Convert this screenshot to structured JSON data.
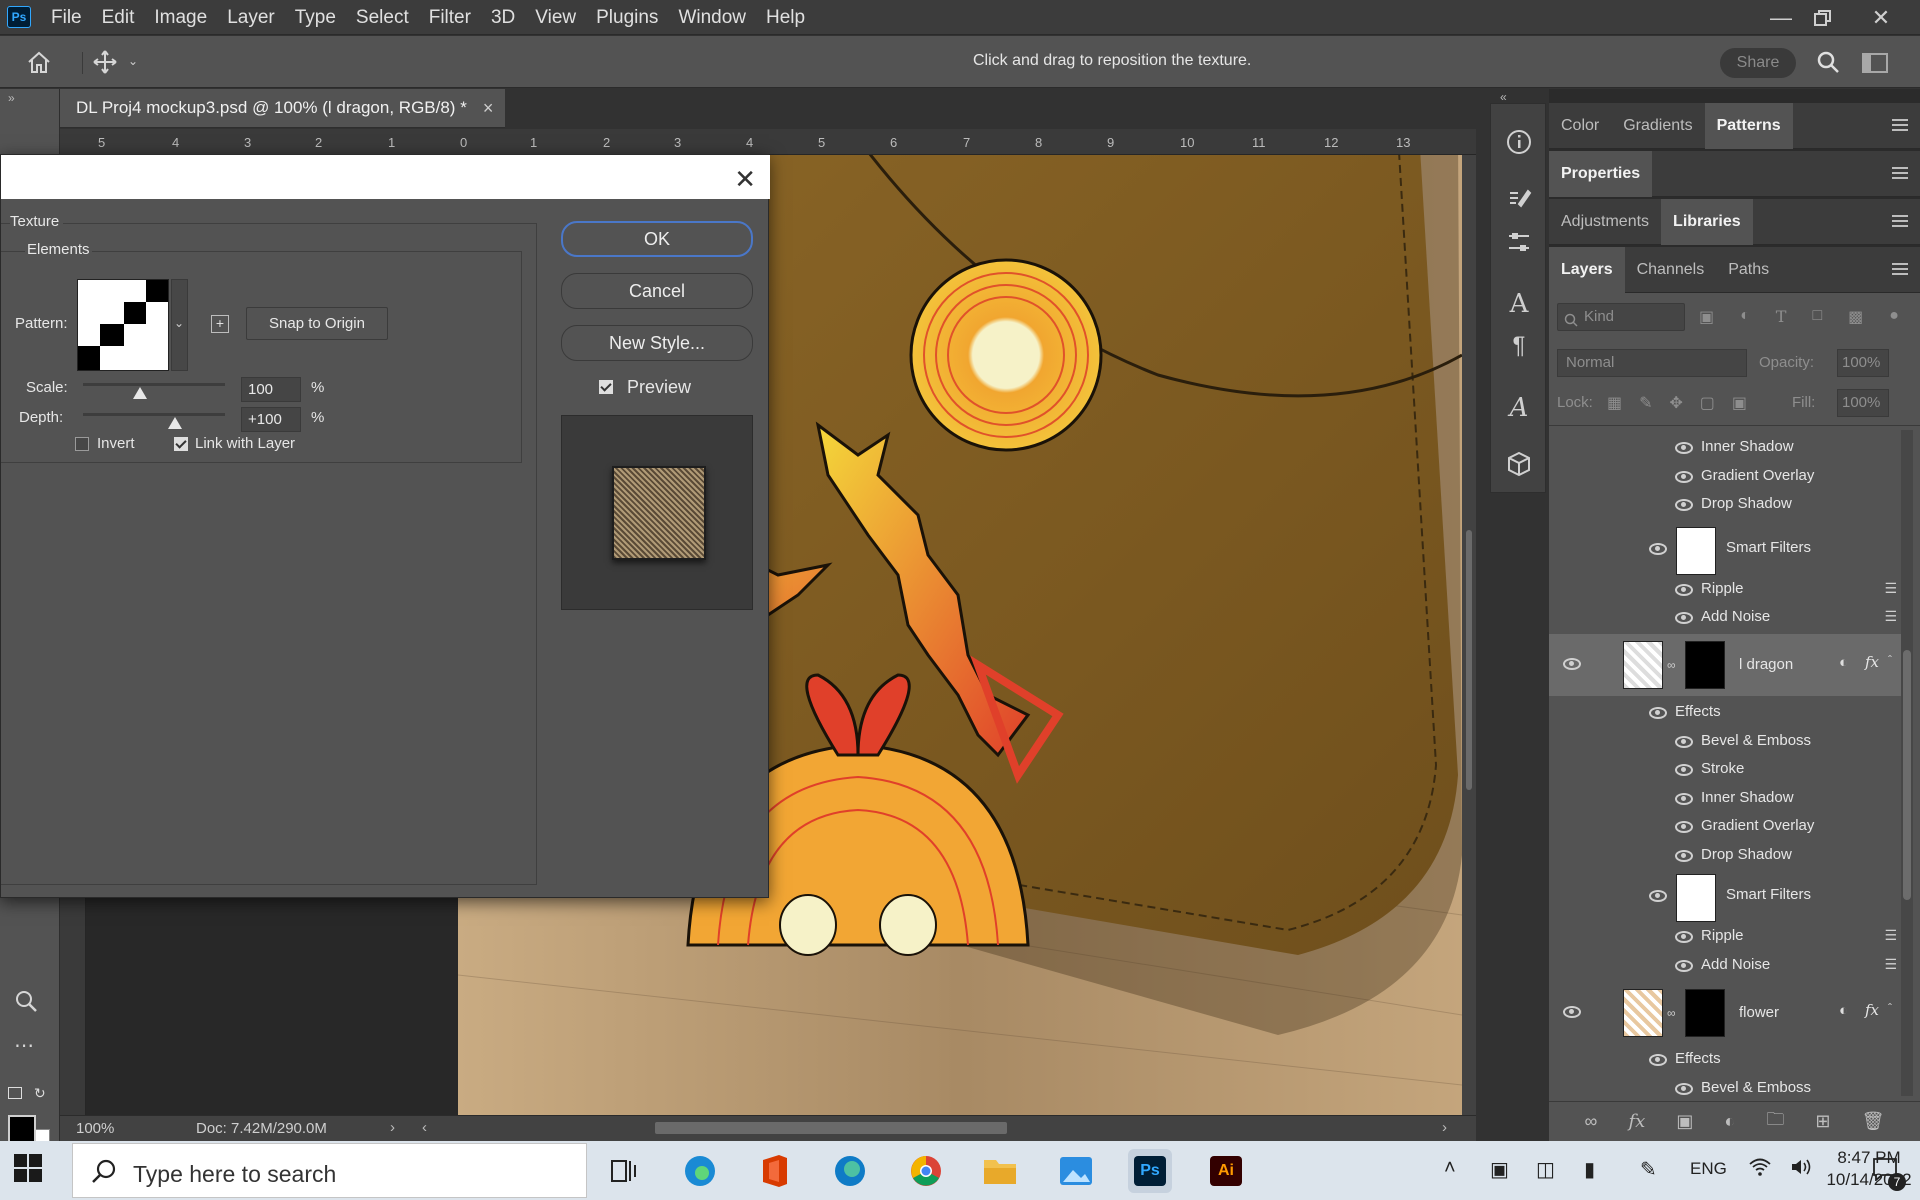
{
  "app": {
    "logo_text": "Ps",
    "menu": [
      "File",
      "Edit",
      "Image",
      "Layer",
      "Type",
      "Select",
      "Filter",
      "3D",
      "View",
      "Plugins",
      "Window",
      "Help"
    ]
  },
  "options_bar": {
    "hint": "Click and drag to reposition the texture.",
    "share_label": "Share"
  },
  "document": {
    "tab_title": "DL Proj4 mockup3.psd @ 100% (l dragon, RGB/8) *",
    "close_glyph": "×",
    "ruler_top_labels": [
      "5",
      "4",
      "3",
      "2",
      "1",
      "0",
      "1",
      "2",
      "3",
      "4",
      "5",
      "6",
      "7",
      "8",
      "9",
      "10",
      "11",
      "12",
      "13"
    ]
  },
  "status": {
    "zoom": "100%",
    "doc": "Doc: 7.42M/290.0M"
  },
  "dialog": {
    "section_title": "Texture",
    "group_title": "Elements",
    "pattern_label": "Pattern:",
    "snap_label": "Snap to Origin",
    "scale_label": "Scale:",
    "scale_value": "100",
    "scale_fraction": 0.4,
    "depth_label": "Depth:",
    "depth_value": "+100",
    "depth_fraction": 0.65,
    "percent": "%",
    "invert_label": "Invert",
    "invert_checked": false,
    "link_label": "Link with Layer",
    "link_checked": true,
    "ok_label": "OK",
    "cancel_label": "Cancel",
    "new_style_label": "New Style...",
    "preview_label": "Preview",
    "preview_checked": true
  },
  "panels": {
    "row1": [
      "Color",
      "Gradients",
      "Patterns"
    ],
    "row2": [
      "Properties"
    ],
    "row3": [
      "Adjustments",
      "Libraries"
    ],
    "row4": [
      "Layers",
      "Channels",
      "Paths"
    ],
    "kind_label": "Kind",
    "blend_mode": "Normal",
    "opacity_label": "Opacity:",
    "opacity_value": "100%",
    "lock_label": "Lock:",
    "fill_label": "Fill:",
    "fill_value": "100%"
  },
  "layers": {
    "top_effects": [
      "Inner Shadow",
      "Gradient Overlay",
      "Drop Shadow"
    ],
    "smart_filters_label": "Smart Filters",
    "smart_filters_top": [
      "Ripple",
      "Add Noise"
    ],
    "dragon_name": "l dragon",
    "effects_label": "Effects",
    "dragon_effects": [
      "Bevel & Emboss",
      "Stroke",
      "Inner Shadow",
      "Gradient Overlay",
      "Drop Shadow"
    ],
    "dragon_filters": [
      "Ripple",
      "Add Noise"
    ],
    "flower_name": "flower",
    "flower_effects": [
      "Bevel & Emboss"
    ],
    "fx_label": "fx"
  },
  "taskbar": {
    "search_placeholder": "Type here to search",
    "lang": "ENG",
    "time": "8:47 PM",
    "date": "10/14/2022",
    "notif_count": "7",
    "ps_label": "Ps",
    "ai_label": "Ai"
  },
  "colors": {
    "accent_blue": "#4a77c8",
    "ps_blue": "#31a8ff",
    "ai_orange": "#ff9a00"
  }
}
